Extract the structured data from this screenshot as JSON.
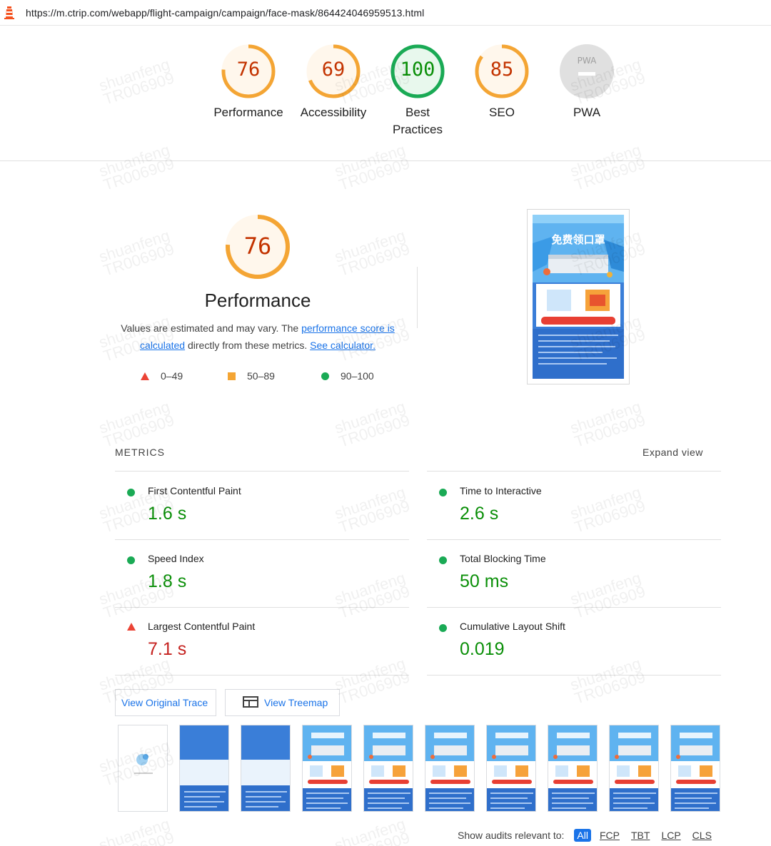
{
  "url_bar": {
    "url": "https://m.ctrip.com/webapp/flight-campaign/campaign/face-mask/864424046959513.html"
  },
  "categories": [
    {
      "score": "76",
      "label": "Performance",
      "status": "average",
      "color": "#c33300",
      "ring": "#f4a534",
      "fill": "#fff7ec",
      "fraction": 0.76
    },
    {
      "score": "69",
      "label": "Accessibility",
      "status": "average",
      "color": "#c33300",
      "ring": "#f4a534",
      "fill": "#fff7ec",
      "fraction": 0.69
    },
    {
      "score": "100",
      "label": "Best Practices",
      "status": "pass",
      "color": "#0a8f08",
      "ring": "#1aaa55",
      "fill": "#e8f8ed",
      "fraction": 1.0
    },
    {
      "score": "85",
      "label": "SEO",
      "status": "average",
      "color": "#c33300",
      "ring": "#f4a534",
      "fill": "#fff7ec",
      "fraction": 0.85
    },
    {
      "badge": "PWA",
      "label": "PWA",
      "status": "na"
    }
  ],
  "performance": {
    "score": "76",
    "fraction": 0.76,
    "title": "Performance",
    "desc_pre": "Values are estimated and may vary. The ",
    "desc_link1": "performance score is calculated",
    "desc_mid": " directly from these metrics. ",
    "desc_link2": "See calculator."
  },
  "legend": [
    {
      "range": "0–49",
      "shape": "triangle",
      "color": "#eb4335"
    },
    {
      "range": "50–89",
      "shape": "square",
      "color": "#f4a534"
    },
    {
      "range": "90–100",
      "shape": "circle",
      "color": "#1aaa55"
    }
  ],
  "metrics": {
    "header": "METRICS",
    "expand": "Expand view",
    "items": [
      {
        "name": "First Contentful Paint",
        "value": "1.6 s",
        "status": "pass"
      },
      {
        "name": "Time to Interactive",
        "value": "2.6 s",
        "status": "pass"
      },
      {
        "name": "Speed Index",
        "value": "1.8 s",
        "status": "pass"
      },
      {
        "name": "Total Blocking Time",
        "value": "50 ms",
        "status": "pass"
      },
      {
        "name": "Largest Contentful Paint",
        "value": "7.1 s",
        "status": "fail"
      },
      {
        "name": "Cumulative Layout Shift",
        "value": "0.019",
        "status": "pass"
      }
    ]
  },
  "buttons": {
    "trace": "View Original Trace",
    "treemap": "View Treemap"
  },
  "screenshot": {
    "headline": "免费领口罩"
  },
  "filter": {
    "label": "Show audits relevant to:",
    "chips": [
      "All",
      "FCP",
      "TBT",
      "LCP",
      "CLS"
    ]
  },
  "watermark": [
    "shuanfeng",
    "TR006909"
  ]
}
